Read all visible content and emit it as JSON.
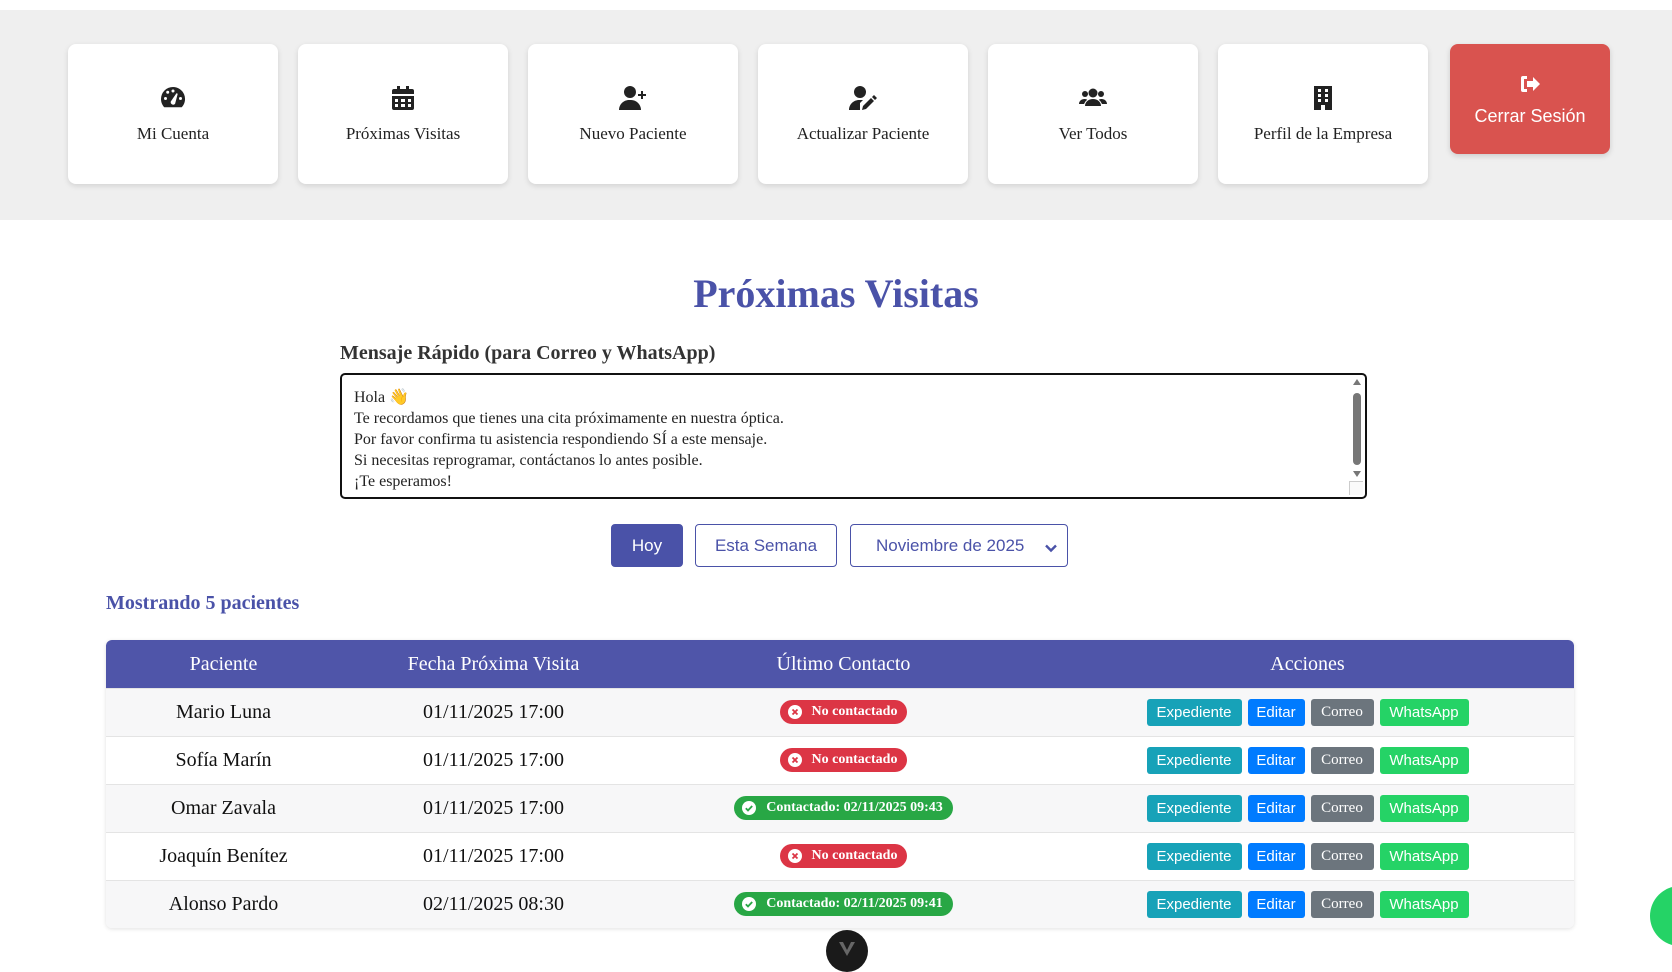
{
  "nav": {
    "items": [
      {
        "label": "Mi Cuenta",
        "icon": "gauge-icon"
      },
      {
        "label": "Próximas Visitas",
        "icon": "calendar-icon"
      },
      {
        "label": "Nuevo Paciente",
        "icon": "user-plus-icon"
      },
      {
        "label": "Actualizar Paciente",
        "icon": "user-edit-icon"
      },
      {
        "label": "Ver Todos",
        "icon": "users-icon"
      },
      {
        "label": "Perfil de la Empresa",
        "icon": "building-icon"
      }
    ],
    "logout_label": "Cerrar Sesión",
    "logout_icon": "sign-out-icon",
    "logout_color": "#d9534f"
  },
  "page": {
    "title": "Próximas Visitas",
    "accent_color": "#4a52a8"
  },
  "quick_message": {
    "label": "Mensaje Rápido (para Correo y WhatsApp)",
    "lines": [
      "Hola 👋",
      "Te recordamos que tienes una cita próximamente en nuestra óptica.",
      "Por favor confirma tu asistencia respondiendo SÍ a este mensaje.",
      "Si necesitas reprogramar, contáctanos lo antes posible.",
      "¡Te esperamos!"
    ]
  },
  "filters": {
    "today_label": "Hoy",
    "week_label": "Esta Semana",
    "month_selected": "Noviembre de 2025"
  },
  "showing_text": "Mostrando 5 pacientes",
  "table": {
    "headers": [
      "Paciente",
      "Fecha Próxima Visita",
      "Último Contacto",
      "Acciones"
    ],
    "rows": [
      {
        "patient": "Mario Luna",
        "date": "01/11/2025 17:00",
        "status": "No contactado",
        "contacted": false
      },
      {
        "patient": "Sofía Marín",
        "date": "01/11/2025 17:00",
        "status": "No contactado",
        "contacted": false
      },
      {
        "patient": "Omar Zavala",
        "date": "01/11/2025 17:00",
        "status": "Contactado: 02/11/2025 09:43",
        "contacted": true
      },
      {
        "patient": "Joaquín Benítez",
        "date": "01/11/2025 17:00",
        "status": "No contactado",
        "contacted": false
      },
      {
        "patient": "Alonso Pardo",
        "date": "02/11/2025 08:30",
        "status": "Contactado: 02/11/2025 09:41",
        "contacted": true
      }
    ],
    "actions": {
      "record": "Expediente",
      "edit": "Editar",
      "email": "Correo",
      "whatsapp": "WhatsApp"
    },
    "header_color": "#4f55a9"
  },
  "colors": {
    "not_contacted": "#dc3545",
    "contacted": "#28a745",
    "record_btn": "#17a2b8",
    "edit_btn": "#007bff",
    "email_btn": "#6c757d",
    "whatsapp_btn": "#25d366"
  }
}
